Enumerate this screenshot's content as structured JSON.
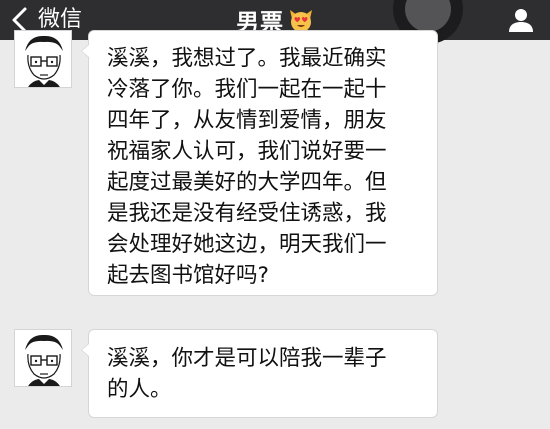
{
  "navbar": {
    "back_label": "微信",
    "title": "男票",
    "title_emoji": "heart-eyes-cat-emoji"
  },
  "icons": {
    "back": "chevron-left-icon",
    "profile": "person-icon"
  },
  "colors": {
    "navbar_bg": "#2e2e31",
    "chat_bg": "#ebebeb",
    "bubble_bg": "#ffffff",
    "text": "#111111"
  },
  "messages": [
    {
      "sender": "男票",
      "lines": [
        "溪溪，我想过了。我最近确实",
        "冷落了你。我们一起在一起十",
        "四年了，从友情到爱情，朋友",
        "祝福家人认可，我们说好要一",
        "起度过最美好的大学四年。但",
        "是我还是没有经受住诱惑，我",
        "会处理好她这边，明天我们一",
        "起去图书馆好吗?"
      ]
    },
    {
      "sender": "男票",
      "lines": [
        "溪溪，你才是可以陪我一辈子",
        "的人。"
      ]
    }
  ]
}
